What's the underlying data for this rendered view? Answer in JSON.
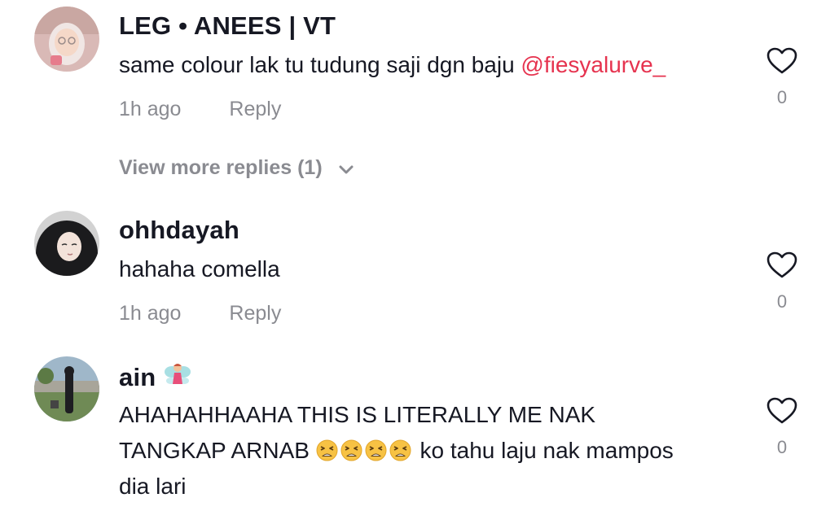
{
  "comments": [
    {
      "username": "LEG • ANEES | VT",
      "text": "same colour lak tu tudung saji dgn baju ",
      "mention": "@fiesyalurve_",
      "time": "1h ago",
      "reply_label": "Reply",
      "like_count": "0",
      "view_more": "View more replies (1)"
    },
    {
      "username": "ohhdayah",
      "text": "hahaha comella",
      "time": "1h ago",
      "reply_label": "Reply",
      "like_count": "0"
    },
    {
      "username": "ain",
      "username_emoji": "fairy-emoji",
      "text_line1": "AHAHAHHAAHA THIS IS LITERALLY ME NAK",
      "text_line2_before": "TANGKAP ARNAB ",
      "text_line2_emojis": [
        "tired-face-emoji",
        "tired-face-emoji",
        "tired-face-emoji",
        "tired-face-emoji"
      ],
      "text_line2_after": " ko tahu laju nak mampos",
      "text_line3": "dia lari",
      "like_count": "0"
    }
  ],
  "colors": {
    "text": "#161823",
    "muted": "#8a8b91",
    "mention": "#e6334f",
    "background": "#ffffff"
  },
  "icons": {
    "like": "heart-outline-icon",
    "expand": "chevron-down-icon"
  }
}
